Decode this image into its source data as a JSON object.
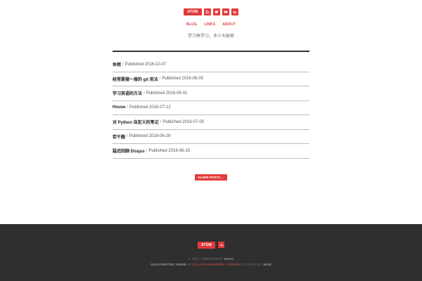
{
  "header": {
    "social": {
      "atom_label": "ATOM",
      "icons": [
        "rss-icon",
        "twitter-icon",
        "youtube-icon",
        "linkedin-icon"
      ]
    },
    "nav": [
      {
        "label": "BLOG"
      },
      {
        "label": "LINKS"
      },
      {
        "label": "ABOUT"
      }
    ],
    "tagline": "学习再学习，多少大秘密"
  },
  "posts": [
    {
      "title": "休假",
      "published": "Published 2016-10-07"
    },
    {
      "title": "经常要搜一搜的 git 用法",
      "published": "Published 2016-08-05"
    },
    {
      "title": "学习英语的方法",
      "published": "Published 2016-08-01"
    },
    {
      "title": "House",
      "published": "Published 2016-07-12"
    },
    {
      "title": "对 Python 自定义的笔记",
      "published": "Published 2016-07-05"
    },
    {
      "title": "若干题",
      "published": "Published 2016-06-28"
    },
    {
      "title": "猛迟回顾 Disqus",
      "published": "Published 2016-06-15"
    }
  ],
  "pagination": {
    "older_label": "OLDER POSTS →"
  },
  "footer": {
    "atom_label": "ATOM",
    "line1_prefix": "© 2016 · POWERED BY",
    "line1_brand": "HUGO",
    "line2_theme": "GHOSTWRITER THEME",
    "line2_by": "BY",
    "line2_author": "JOLLYGOODTHEMES",
    "line2_ported": "· PORTED",
    "line2_to": "TO HUGO BY",
    "line2_porter": "JBUB"
  },
  "colors": {
    "accent": "#e23b3b",
    "footer_bg": "#2f2f2f"
  }
}
